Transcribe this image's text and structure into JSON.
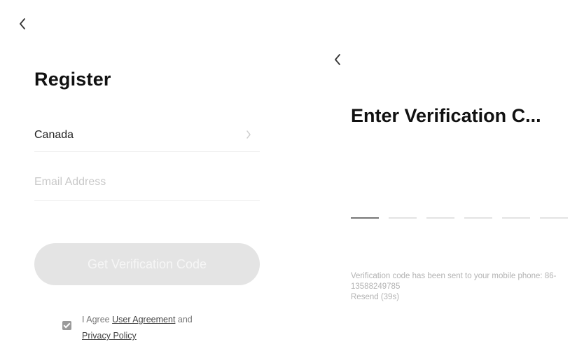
{
  "register": {
    "title": "Register",
    "country": "Canada",
    "email_placeholder": "Email Address",
    "get_code_label": "Get Verification Code",
    "agreement": {
      "prefix": "I Agree ",
      "user_agreement": "User Agreement",
      "middle": " and ",
      "privacy_policy": "Privacy Policy",
      "checked": true
    }
  },
  "verify": {
    "title": "Enter Verification C...",
    "code_slots": 6,
    "info_line": "Verification code has been sent to your mobile phone: 86-13588249785",
    "resend": "Resend (39s)"
  },
  "icons": {
    "back": "chevron-left-icon",
    "country_chevron": "chevron-right-icon",
    "checkbox": "check-icon"
  },
  "colors": {
    "button_disabled_bg": "#e4e4e4",
    "button_disabled_text": "#f6f6f6",
    "placeholder": "#c9c9c9",
    "info_text": "#b3b3b3",
    "checkbox_bg": "#9a9a9a"
  }
}
